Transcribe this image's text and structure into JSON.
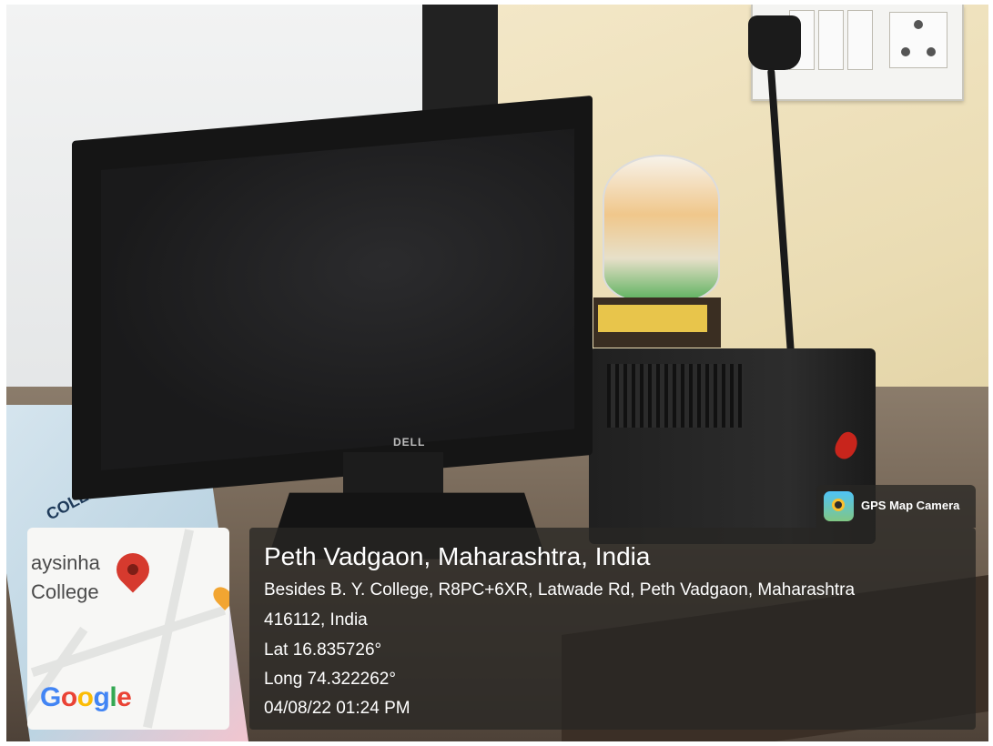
{
  "overlay": {
    "badge_label": "GPS Map Camera",
    "location_title": "Peth Vadgaon, Maharashtra, India",
    "address_line1": "Besides B. Y. College, R8PC+6XR, Latwade Rd, Peth Vadgaon, Maharashtra",
    "address_line2": "416112, India",
    "latitude": "Lat 16.835726°",
    "longitude": "Long 74.322262°",
    "datetime": "04/08/22 01:24 PM"
  },
  "map": {
    "label_line1": "aysinha",
    "label_line2": "College",
    "logo_letters": [
      "G",
      "o",
      "o",
      "g",
      "l",
      "e"
    ]
  },
  "scene": {
    "monitor_brand": "DELL",
    "paper_text": "COLLEGE,"
  },
  "colors": {
    "overlay_bg": "#282624",
    "pin": "#d63a2e",
    "google_blue": "#4285f4",
    "google_red": "#ea4335",
    "google_yellow": "#fbbc05",
    "google_green": "#34a853"
  }
}
